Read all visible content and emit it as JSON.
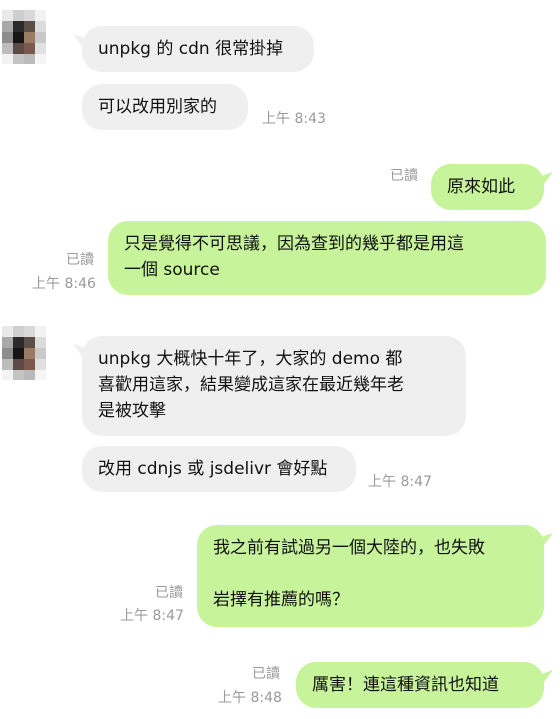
{
  "chat": {
    "messages": [
      {
        "text": "unpkg 的 cdn 很常掛掉"
      },
      {
        "text": "可以改用別家的",
        "time": "上午 8:43"
      },
      {
        "text": "原來如此",
        "read": "已讀"
      },
      {
        "text": "只是覺得不可思議，因為查到的幾乎都是用這\n一個 source",
        "read": "已讀",
        "time": "上午 8:46"
      },
      {
        "text": "unpkg 大概快十年了，大家的 demo 都\n喜歡用這家，結果變成這家在最近幾年老\n是被攻擊"
      },
      {
        "text": "改用 cdnjs 或 jsdelivr 會好點",
        "time": "上午 8:47"
      },
      {
        "text": "我之前有試過另一個大陸的，也失敗\n\n岩擇有推薦的嗎？",
        "read": "已讀",
        "time": "上午 8:47"
      },
      {
        "text": "厲害！連這種資訊也知道",
        "read": "已讀",
        "time": "上午 8:48"
      }
    ]
  },
  "colors": {
    "incoming_bubble": "#efefef",
    "outgoing_bubble": "#c7f39a",
    "meta_text": "#9a9a9a"
  }
}
